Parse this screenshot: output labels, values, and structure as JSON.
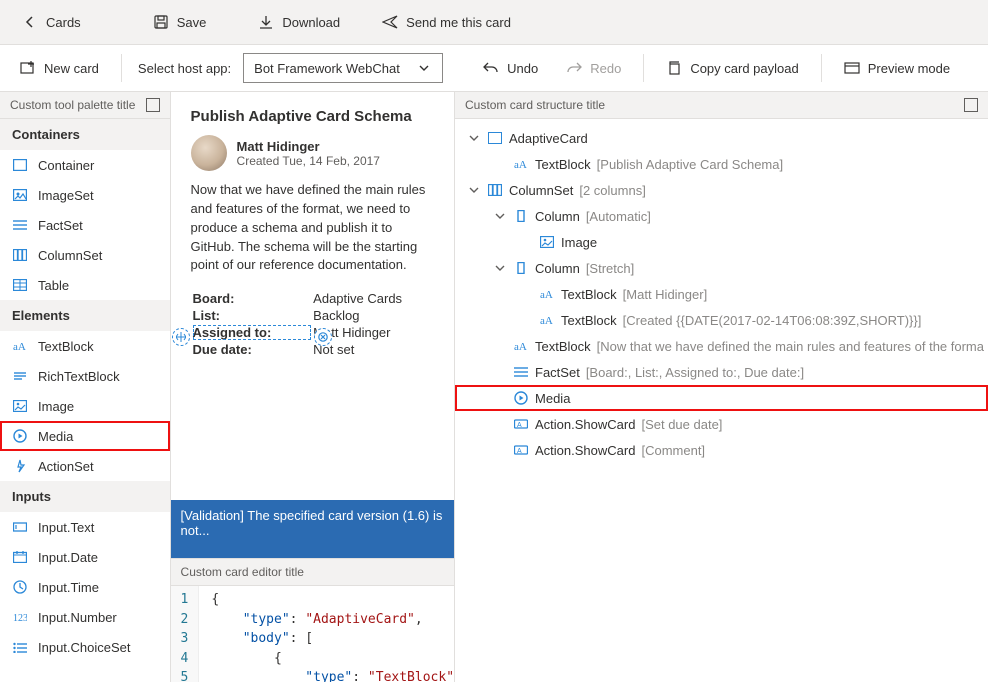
{
  "topbar": {
    "back": "Cards",
    "save": "Save",
    "download": "Download",
    "send": "Send me this card"
  },
  "toolbar": {
    "new_card": "New card",
    "select_host": "Select host app:",
    "host_value": "Bot Framework WebChat",
    "undo": "Undo",
    "redo": "Redo",
    "copy_payload": "Copy card payload",
    "preview_mode": "Preview mode"
  },
  "left_pane": {
    "title": "Custom tool palette title",
    "sections": [
      {
        "header": "Containers",
        "items": [
          "Container",
          "ImageSet",
          "FactSet",
          "ColumnSet",
          "Table"
        ]
      },
      {
        "header": "Elements",
        "items": [
          "TextBlock",
          "RichTextBlock",
          "Image",
          "Media",
          "ActionSet"
        ]
      },
      {
        "header": "Inputs",
        "items": [
          "Input.Text",
          "Input.Date",
          "Input.Time",
          "Input.Number",
          "Input.ChoiceSet"
        ]
      }
    ],
    "highlighted": "Media"
  },
  "preview": {
    "title": "Publish Adaptive Card Schema",
    "author_name": "Matt Hidinger",
    "author_sub": "Created Tue, 14 Feb, 2017",
    "body": "Now that we have defined the main rules and features of the format, we need to produce a schema and publish it to GitHub. The schema will be the starting point of our reference documentation.",
    "facts": [
      {
        "k": "Board:",
        "v": "Adaptive Cards"
      },
      {
        "k": "List:",
        "v": "Backlog"
      },
      {
        "k": "Assigned to:",
        "v": "Matt Hidinger"
      },
      {
        "k": "Due date:",
        "v": "Not set"
      }
    ],
    "selected_fact_index": 2,
    "validation": "[Validation] The specified card version (1.6) is not..."
  },
  "right_pane": {
    "title": "Custom card structure title",
    "tree": [
      {
        "indent": 0,
        "twisty": "down",
        "icon": "card",
        "label": "AdaptiveCard",
        "sub": ""
      },
      {
        "indent": 1,
        "twisty": "",
        "icon": "text",
        "label": "TextBlock",
        "sub": "[Publish Adaptive Card Schema]"
      },
      {
        "indent": 0,
        "twisty": "down",
        "icon": "columnset",
        "label": "ColumnSet",
        "sub": "[2 columns]"
      },
      {
        "indent": 1,
        "twisty": "down",
        "icon": "column",
        "label": "Column",
        "sub": "[Automatic]"
      },
      {
        "indent": 2,
        "twisty": "",
        "icon": "image",
        "label": "Image",
        "sub": ""
      },
      {
        "indent": 1,
        "twisty": "down",
        "icon": "column",
        "label": "Column",
        "sub": "[Stretch]"
      },
      {
        "indent": 2,
        "twisty": "",
        "icon": "text",
        "label": "TextBlock",
        "sub": "[Matt Hidinger]"
      },
      {
        "indent": 2,
        "twisty": "",
        "icon": "text",
        "label": "TextBlock",
        "sub": "[Created {{DATE(2017-02-14T06:08:39Z,SHORT)}}]"
      },
      {
        "indent": 1,
        "twisty": "",
        "icon": "text",
        "label": "TextBlock",
        "sub": "[Now that we have defined the main rules and features of the forma"
      },
      {
        "indent": 1,
        "twisty": "",
        "icon": "factset",
        "label": "FactSet",
        "sub": "[Board:, List:, Assigned to:, Due date:]"
      },
      {
        "indent": 1,
        "twisty": "",
        "icon": "media",
        "label": "Media",
        "sub": "",
        "highlight": true
      },
      {
        "indent": 1,
        "twisty": "",
        "icon": "action",
        "label": "Action.ShowCard",
        "sub": "[Set due date]"
      },
      {
        "indent": 1,
        "twisty": "",
        "icon": "action",
        "label": "Action.ShowCard",
        "sub": "[Comment]"
      }
    ]
  },
  "editor": {
    "title": "Custom card editor title",
    "lines": [
      {
        "n": "1",
        "raw": "{"
      },
      {
        "n": "2",
        "raw": "    \"type\": \"AdaptiveCard\","
      },
      {
        "n": "3",
        "raw": "    \"body\": ["
      },
      {
        "n": "4",
        "raw": "        {"
      },
      {
        "n": "5",
        "raw": "            \"type\": \"TextBlock\""
      }
    ]
  }
}
